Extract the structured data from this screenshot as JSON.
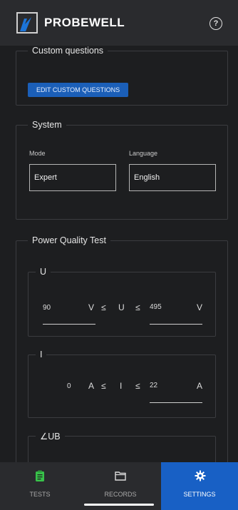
{
  "header": {
    "brand": "PROBEWELL",
    "help_symbol": "?"
  },
  "custom_questions": {
    "legend": "Custom questions",
    "edit_button": "EDIT CUSTOM QUESTIONS"
  },
  "system": {
    "legend": "System",
    "mode_label": "Mode",
    "mode_value": "Expert",
    "language_label": "Language",
    "language_value": "English"
  },
  "power_quality": {
    "legend": "Power Quality Test",
    "voltage": {
      "legend": "U",
      "min": "90",
      "unit_left": "V",
      "le1": "≤",
      "symbol": "U",
      "le2": "≤",
      "max": "495",
      "unit_right": "V"
    },
    "current": {
      "legend": "I",
      "min": "0",
      "unit_left": "A",
      "le1": "≤",
      "symbol": "I",
      "le2": "≤",
      "max": "22",
      "unit_right": "A"
    },
    "angle": {
      "legend": "∠UB"
    }
  },
  "nav": {
    "tests": "TESTS",
    "records": "RECORDS",
    "settings": "SETTINGS",
    "active": "settings"
  },
  "colors": {
    "accent": "#1860c5",
    "button": "#1b5fb8",
    "tests_icon": "#38c24a",
    "background": "#1d1e20"
  },
  "icons": {
    "logo": "probewell-logo-icon",
    "help": "help-circle-icon",
    "tests": "clipboard-icon",
    "records": "folder-icon",
    "settings": "gear-icon"
  }
}
